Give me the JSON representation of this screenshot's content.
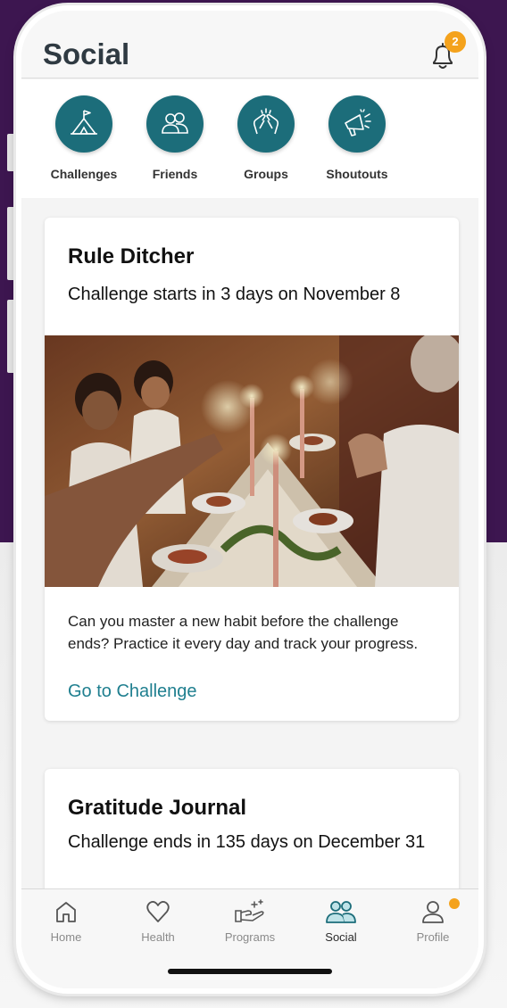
{
  "header": {
    "title": "Social",
    "notification_count": "2"
  },
  "quick_nav": [
    {
      "label": "Challenges",
      "icon": "tent-flag-icon"
    },
    {
      "label": "Friends",
      "icon": "friends-icon"
    },
    {
      "label": "Groups",
      "icon": "hands-icon"
    },
    {
      "label": "Shoutouts",
      "icon": "megaphone-icon"
    }
  ],
  "cards": [
    {
      "title": "Rule Ditcher",
      "subtitle": "Challenge starts in 3 days on November 8",
      "description": "Can you master a new habit before the challenge ends? Practice it every day and track your progress.",
      "link": "Go to Challenge"
    },
    {
      "title": "Gratitude Journal",
      "subtitle": "Challenge ends in 135 days on December 31"
    }
  ],
  "tabbar": {
    "active": "Social",
    "items": [
      {
        "label": "Home",
        "icon": "home-icon"
      },
      {
        "label": "Health",
        "icon": "heart-icon"
      },
      {
        "label": "Programs",
        "icon": "hand-sparkle-icon"
      },
      {
        "label": "Social",
        "icon": "people-icon"
      },
      {
        "label": "Profile",
        "icon": "person-icon"
      }
    ]
  },
  "colors": {
    "accent": "#1c6d7a",
    "link": "#1f7f8f",
    "badge": "#f4a21c",
    "background_purple": "#3d1650"
  }
}
